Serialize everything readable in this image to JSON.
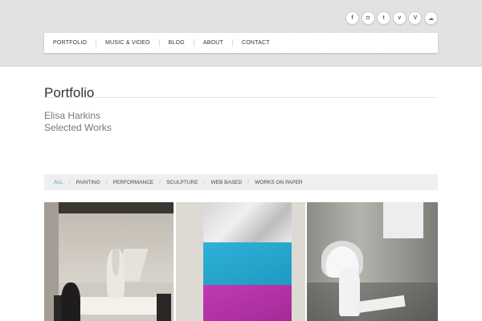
{
  "social": [
    {
      "icon": "facebook-icon",
      "glyph": "f"
    },
    {
      "icon": "instagram-icon",
      "glyph": "◘"
    },
    {
      "icon": "tumblr-icon",
      "glyph": "t"
    },
    {
      "icon": "twitter-icon",
      "glyph": "v"
    },
    {
      "icon": "vimeo-icon",
      "glyph": "V"
    },
    {
      "icon": "soundcloud-icon",
      "glyph": "☁"
    }
  ],
  "nav": {
    "items": [
      "PORTFOLIO",
      "MUSIC & VIDEO",
      "BLOG",
      "ABOUT",
      "CONTACT"
    ]
  },
  "page": {
    "title": "Portfolio",
    "intro_line1": "Elisa Harkins",
    "intro_line2": "Selected Works"
  },
  "filters": {
    "items": [
      "ALL",
      "PAINTING",
      "PERFORMANCE",
      "SCULPTURE",
      "WEB BASED",
      "WORKS ON PAPER"
    ],
    "separator": "/",
    "active_color": "#3aa0c8"
  },
  "gallery": {
    "items": [
      {
        "name": "performance-white-dress"
      },
      {
        "name": "painting-silver-blue-magenta"
      },
      {
        "name": "performance-headdress-microphone"
      }
    ]
  }
}
